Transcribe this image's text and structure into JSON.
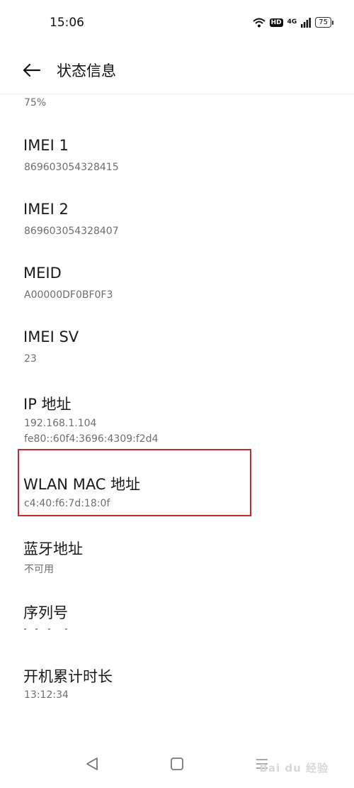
{
  "status_bar": {
    "time": "15:06",
    "hd": "HD",
    "network": "4G",
    "battery": "75"
  },
  "header": {
    "title": "状态信息"
  },
  "partial_value": "75%",
  "items": [
    {
      "title": "IMEI 1",
      "value": "869603054328415"
    },
    {
      "title": "IMEI 2",
      "value": "869603054328407"
    },
    {
      "title": "MEID",
      "value": "A00000DF0BF0F3"
    },
    {
      "title": "IMEI SV",
      "value": "23"
    },
    {
      "title": "IP 地址",
      "value": "192.168.1.104",
      "value2": "fe80::60f4:3696:4309:f2d4"
    },
    {
      "title": "WLAN MAC 地址",
      "value": "c4:40:f6:7d:18:0f"
    },
    {
      "title": "蓝牙地址",
      "value": "不可用"
    },
    {
      "title": "序列号",
      "value": ""
    },
    {
      "title": "开机累计时长",
      "value": "13:12:34"
    }
  ],
  "watermark": "Bai du 经验",
  "colors": {
    "highlight": "#c62b2b",
    "secondary_text": "#6e6e6e"
  }
}
